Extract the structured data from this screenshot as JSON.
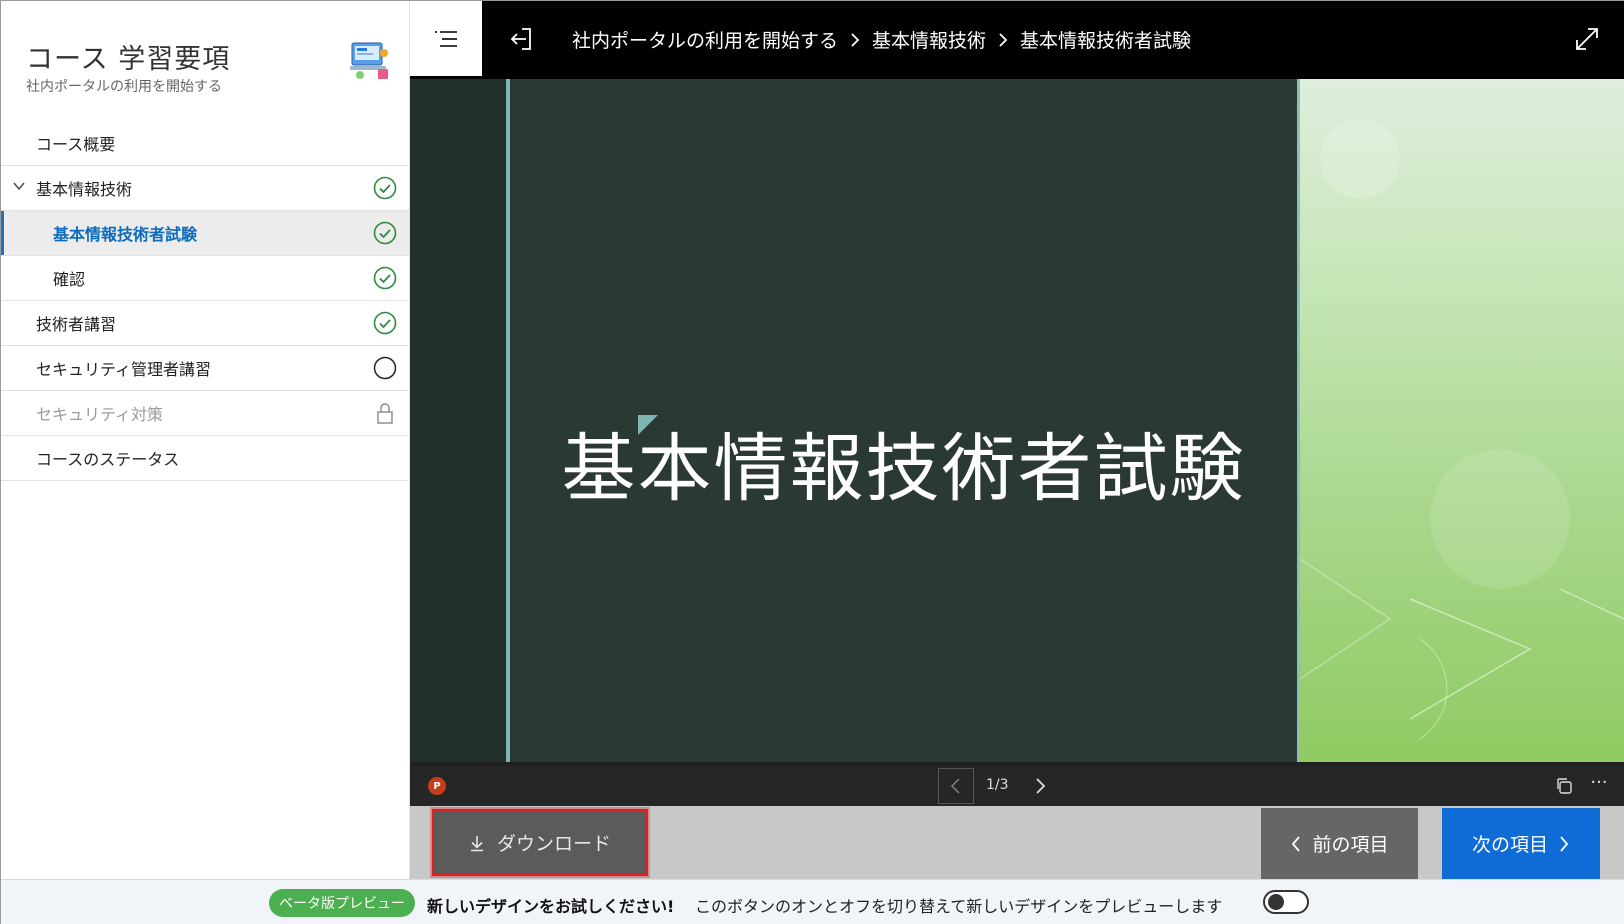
{
  "sidebar": {
    "title": "コース 学習要項",
    "subtitle": "社内ポータルの利用を開始する",
    "items": [
      {
        "label": "コース概要"
      },
      {
        "label": "基本情報技術",
        "status": "complete"
      },
      {
        "label": "基本情報技術者試験",
        "status": "complete"
      },
      {
        "label": "確認",
        "status": "complete"
      },
      {
        "label": "技術者講習",
        "status": "complete"
      },
      {
        "label": "セキュリティ管理者講習",
        "status": "incomplete"
      },
      {
        "label": "セキュリティ対策",
        "status": "locked"
      },
      {
        "label": "コースのステータス"
      }
    ]
  },
  "header": {
    "breadcrumb": [
      "社内ポータルの利用を開始する",
      "基本情報技術",
      "基本情報技術者試験"
    ]
  },
  "viewer": {
    "slide_title": "基本情報技術者試験",
    "page_indicator": "1/3",
    "file_badge": "P"
  },
  "actions": {
    "download_label": "ダウンロード",
    "prev_label": "前の項目",
    "next_label": "次の項目"
  },
  "beta": {
    "badge": "ベータ版プレビュー",
    "bold_text": "新しいデザインをお試しください!",
    "text": "このボタンのオンとオフを切り替えて新しいデザインをプレビューします"
  },
  "colors": {
    "accent": "#0f6cbd",
    "complete": "#2e8b3d",
    "next_button": "#0f6cd6",
    "beta_badge": "#4caf50"
  }
}
